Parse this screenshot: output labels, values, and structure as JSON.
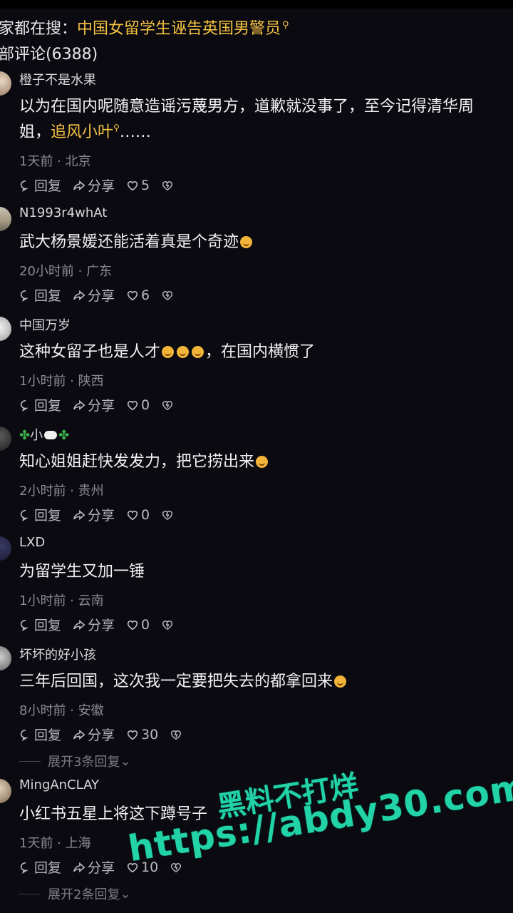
{
  "search_hint": {
    "prefix": "家都在搜：",
    "highlight": "中国女留学生诬告英国男警员"
  },
  "comment_count": "部评论(6388)",
  "actions": {
    "reply": "回复",
    "share": "分享"
  },
  "comments": [
    {
      "user": "橙子不是水果",
      "text_a": "以为在国内呢随意造谣污蔑男方，道歉就没事了，至今记得清华周",
      "text_b": "姐，",
      "text_link": "追风小叶",
      "text_c": "……",
      "meta": "1天前 · 北京",
      "likes": "5"
    },
    {
      "user": "N1993r4whAt",
      "text": "武大杨景媛还能活着真是个奇迹",
      "meta": "20小时前 · 广东",
      "likes": "6"
    },
    {
      "user": "中国万岁",
      "text_a": "这种女留子也是人才",
      "text_b": "，在国内横惯了",
      "meta": "1小时前 · 陕西",
      "likes": "0"
    },
    {
      "user": "小",
      "text": "知心姐姐赶快发发力，把它捞出来",
      "meta": "2小时前 · 贵州",
      "likes": "0"
    },
    {
      "user": "LXD",
      "text": "为留学生又加一锤",
      "meta": "1小时前 · 云南",
      "likes": "0"
    },
    {
      "user": "坏坏的好小孩",
      "text": "三年后回国，这次我一定要把失去的都拿回来",
      "meta": "8小时前 · 安徽",
      "likes": "30",
      "expand": "展开3条回复"
    },
    {
      "user": "MingAnCLAY",
      "text": "小红书五星上将这下蹲号子",
      "meta": "1天前 · 上海",
      "likes": "10",
      "expand": "展开2条回复"
    }
  ],
  "watermark": {
    "line1": "黑料不打烊",
    "line2": "https://abdy30.com"
  },
  "colors": {
    "background": "#0a0a10",
    "highlight": "#f5c242",
    "watermark": "#22d3a8"
  }
}
